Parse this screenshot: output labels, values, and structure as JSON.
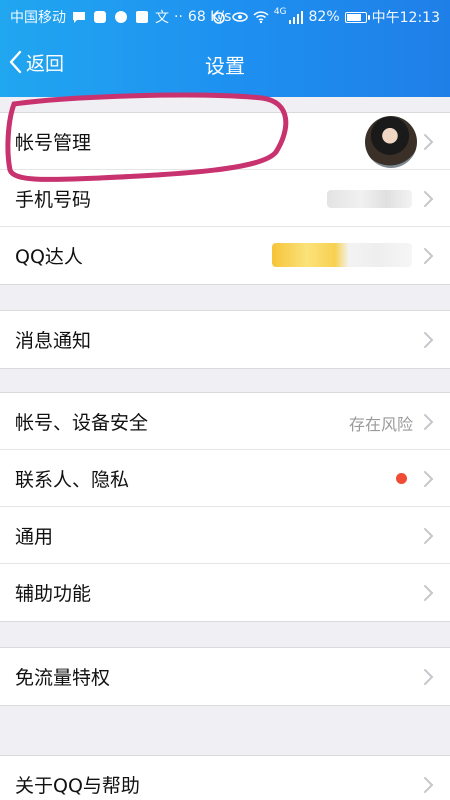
{
  "status_bar": {
    "carrier": "中国移动",
    "speed": "68 K/s",
    "network": "4G",
    "battery": "82%",
    "battery_level": 0.82,
    "time": "中午12:13"
  },
  "nav": {
    "back_label": "返回",
    "title": "设置"
  },
  "groups": [
    {
      "items": [
        {
          "label": "帐号管理"
        },
        {
          "label": "手机号码"
        },
        {
          "label": "QQ达人"
        }
      ]
    },
    {
      "items": [
        {
          "label": "消息通知"
        }
      ]
    },
    {
      "items": [
        {
          "label": "帐号、设备安全",
          "value": "存在风险"
        },
        {
          "label": "联系人、隐私"
        },
        {
          "label": "通用"
        },
        {
          "label": "辅助功能"
        }
      ]
    },
    {
      "items": [
        {
          "label": "免流量特权"
        }
      ]
    },
    {
      "items": [
        {
          "label": "关于QQ与帮助"
        }
      ]
    }
  ],
  "colors": {
    "header_start": "#21a6f0",
    "header_end": "#1f7fe8",
    "red_dot": "#f04b34",
    "annotation": "#c8326e"
  }
}
